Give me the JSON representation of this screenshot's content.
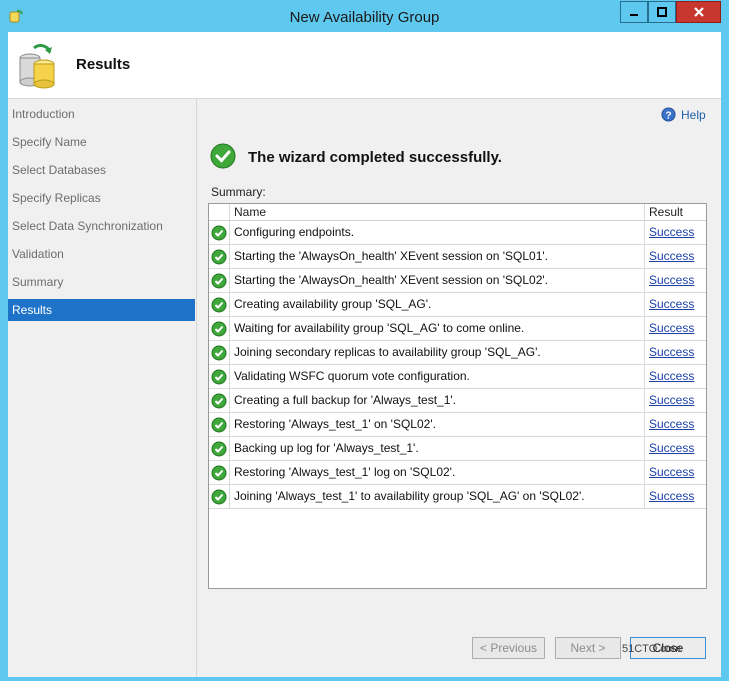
{
  "window": {
    "title": "New Availability Group"
  },
  "header": {
    "title": "Results"
  },
  "nav": {
    "items": [
      {
        "label": "Introduction"
      },
      {
        "label": "Specify Name"
      },
      {
        "label": "Select Databases"
      },
      {
        "label": "Specify Replicas"
      },
      {
        "label": "Select Data Synchronization"
      },
      {
        "label": "Validation"
      },
      {
        "label": "Summary"
      },
      {
        "label": "Results",
        "active": true
      }
    ]
  },
  "main": {
    "help_label": "Help",
    "status_text": "The wizard completed successfully.",
    "summary_label": "Summary:",
    "columns": {
      "name": "Name",
      "result": "Result"
    },
    "rows": [
      {
        "name": "Configuring endpoints.",
        "result": "Success"
      },
      {
        "name": "Starting the 'AlwaysOn_health' XEvent session on 'SQL01'.",
        "result": "Success"
      },
      {
        "name": "Starting the 'AlwaysOn_health' XEvent session on 'SQL02'.",
        "result": "Success"
      },
      {
        "name": "Creating availability group 'SQL_AG'.",
        "result": "Success"
      },
      {
        "name": "Waiting for availability group 'SQL_AG' to come online.",
        "result": "Success"
      },
      {
        "name": "Joining secondary replicas to availability group 'SQL_AG'.",
        "result": "Success"
      },
      {
        "name": "Validating WSFC quorum vote configuration.",
        "result": "Success"
      },
      {
        "name": "Creating a full backup for 'Always_test_1'.",
        "result": "Success"
      },
      {
        "name": "Restoring 'Always_test_1' on 'SQL02'.",
        "result": "Success"
      },
      {
        "name": "Backing up log for 'Always_test_1'.",
        "result": "Success"
      },
      {
        "name": "Restoring 'Always_test_1' log on 'SQL02'.",
        "result": "Success"
      },
      {
        "name": "Joining 'Always_test_1' to availability group 'SQL_AG' on 'SQL02'.",
        "result": "Success"
      }
    ]
  },
  "buttons": {
    "previous": "< Previous",
    "next": "Next >",
    "close": "Close"
  },
  "watermark": "51CTO.com",
  "colors": {
    "title_bar": "#5ec8ee",
    "selected_nav": "#1e73c8",
    "success_green": "#3ea83a",
    "link": "#1a3fa8"
  },
  "icons": {
    "help": "help-icon",
    "success": "success-check-icon",
    "header": "database-cylinder-icon"
  }
}
